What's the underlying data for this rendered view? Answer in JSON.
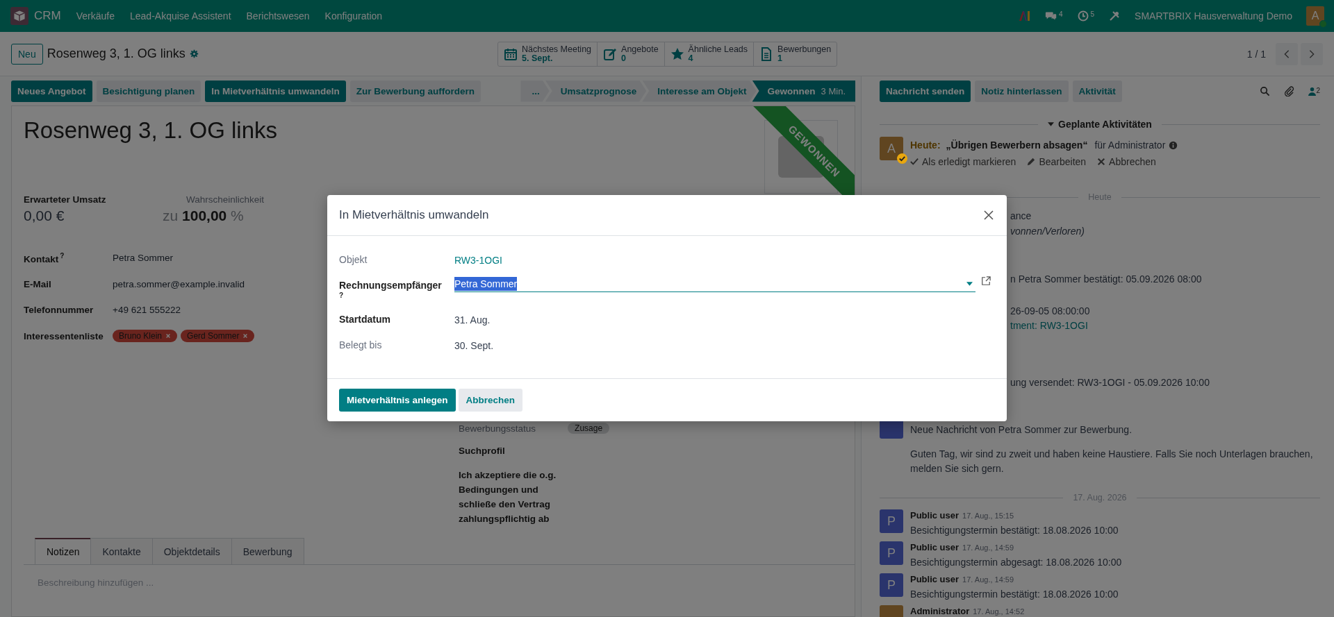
{
  "navbar": {
    "app_name": "CRM",
    "menus": [
      "Verkäufe",
      "Lead-Akquise Assistent",
      "Berichtswesen",
      "Konfiguration"
    ],
    "messages_count": "4",
    "activities_count": "5",
    "company": "SMARTBRIX Hausverwaltung Demo",
    "user_initial": "A"
  },
  "control_panel": {
    "new_button": "Neu",
    "breadcrumb": "Rosenweg 3, 1. OG links",
    "smart_buttons": [
      {
        "kind": "calendar",
        "label": "Nächstes Meeting",
        "value": "5. Sept."
      },
      {
        "kind": "edit",
        "label": "Angebote",
        "value": "0"
      },
      {
        "kind": "star",
        "label": "Ähnliche Leads",
        "value": "4"
      },
      {
        "kind": "document",
        "label": "Bewerbungen",
        "value": "1"
      }
    ],
    "pager": "1 / 1"
  },
  "action_buttons": [
    {
      "label": "Neues Angebot",
      "primary": true
    },
    {
      "label": "Besichtigung planen",
      "primary": false
    },
    {
      "label": "In Mietverhältnis umwandeln",
      "primary": true
    },
    {
      "label": "Zur Bewerbung auffordern",
      "primary": false
    }
  ],
  "stages": [
    {
      "label": "...",
      "selected": false
    },
    {
      "label": "Umsatzprognose",
      "selected": false
    },
    {
      "label": "Interesse am Objekt",
      "selected": false
    },
    {
      "label": "Gewonnen",
      "selected": true,
      "duration": "3 Min."
    }
  ],
  "form": {
    "title": "Rosenweg 3, 1. OG links",
    "ribbon": "GEWONNEN",
    "revenue": {
      "label": "Erwarteter Umsatz",
      "readonly": false,
      "value": "0,00",
      "currency": "€"
    },
    "probability": {
      "label": "Wahrscheinlichkeit",
      "readonly": true,
      "prefix": "zu",
      "value": "100,00",
      "unit": "%"
    },
    "fields": [
      {
        "label": "Kontakt",
        "help": "?",
        "kind": "text",
        "readonly": false,
        "value": "Petra Sommer"
      },
      {
        "label": "E-Mail",
        "kind": "text",
        "readonly": false,
        "value": "petra.sommer@example.invalid"
      },
      {
        "label": "Telefonnummer",
        "kind": "text",
        "readonly": false,
        "value": "+49 621 555222"
      },
      {
        "label": "Interessentenliste",
        "kind": "tags",
        "readonly": false,
        "tags": [
          "Bruno Klein",
          "Gerd Sommer"
        ]
      }
    ],
    "right_fields": [
      {
        "label": "Bewerbungsstatus",
        "kind": "badge",
        "readonly": true,
        "value": "Zusage"
      },
      {
        "label": "Suchprofil",
        "kind": "heading",
        "readonly": false
      },
      {
        "label": "Ich akzeptiere die o.g. Bedingungen und schließe den Vertrag zahlungspflichtig ab",
        "kind": "heading",
        "readonly": false
      }
    ],
    "tabs": [
      {
        "label": "Notizen",
        "selected": true
      },
      {
        "label": "Kontakte",
        "selected": false
      },
      {
        "label": "Objektdetails",
        "selected": false
      },
      {
        "label": "Bewerbung",
        "selected": false
      }
    ],
    "notes_placeholder": "Beschreibung hinzufügen ..."
  },
  "chatter": {
    "buttons": [
      {
        "label": "Nachricht senden",
        "primary": true
      },
      {
        "label": "Notiz hinterlassen",
        "primary": false
      },
      {
        "label": "Aktivität",
        "primary": false
      }
    ],
    "followers_count": "2",
    "planned_title": "Geplante Aktivitäten",
    "activity": {
      "avatar": "A",
      "due": "Heute:",
      "summary": "„Übrigen Bewerbern absagen“",
      "assignee": "für Administrator",
      "actions": [
        {
          "kind": "check",
          "label": "Als erledigt markieren"
        },
        {
          "kind": "pencil",
          "label": "Bearbeiten"
        },
        {
          "kind": "cross",
          "label": "Abbrechen"
        }
      ]
    },
    "today_separator": "Heute",
    "partial_lines": [
      {
        "kind": "text",
        "text": "ance"
      },
      {
        "kind": "italic",
        "text": "vonnen/Verloren)"
      },
      {
        "kind": "text",
        "text": "n Petra Sommer bestätigt: 05.09.2026 08:00"
      },
      {
        "kind": "text",
        "text": "26-09-05 08:00:00"
      },
      {
        "kind": "link",
        "text": "tment: RW3-1OGI"
      },
      {
        "kind": "text",
        "text": "ung versendet: RW3-1OGI - 05.09.2026 10:00"
      }
    ],
    "message": {
      "color": "#2a346c",
      "lines": [
        "Neue Nachricht von Petra Sommer zur Bewerbung.",
        "Guten Tag, wir sind zu zweit und haben keine Haustiere. Falls Sie noch Unterlagen brauchen, melden Sie sich gern."
      ]
    },
    "date_separator": "17. Aug. 2026",
    "messages": [
      {
        "avatar": "P",
        "color": "#2a346c",
        "author": "Public user",
        "time": "17. Aug., 15:15",
        "body": "Besichtigungstermin bestätigt: 18.08.2026 10:00"
      },
      {
        "avatar": "P",
        "color": "#2a346c",
        "author": "Public user",
        "time": "17. Aug., 14:59",
        "body": "Besichtigungstermin abgesagt: 18.08.2026 10:00"
      },
      {
        "avatar": "P",
        "color": "#2a346c",
        "author": "Public user",
        "time": "17. Aug., 14:59",
        "body": "Besichtigungstermin bestätigt: 18.08.2026 10:00"
      },
      {
        "color": "#604520",
        "author": "Administrator",
        "time": "17. Aug., 14:52"
      }
    ]
  },
  "dialog": {
    "title": "In Mietverhältnis umwandeln",
    "fields": [
      {
        "label": "Objekt",
        "kind": "link",
        "readonly": true,
        "value": "RW3-1OGI"
      },
      {
        "label": "Rechnungsempfänger",
        "help": "?",
        "kind": "many2one",
        "readonly": false,
        "value": "Petra Sommer",
        "text_selected": true
      },
      {
        "label": "Startdatum",
        "kind": "text",
        "readonly": false,
        "value": "31. Aug."
      },
      {
        "label": "Belegt bis",
        "kind": "text",
        "readonly": true,
        "value": "30. Sept."
      }
    ],
    "buttons": [
      {
        "label": "Mietverhältnis anlegen",
        "primary": true
      },
      {
        "label": "Abbrechen",
        "primary": false
      }
    ]
  }
}
